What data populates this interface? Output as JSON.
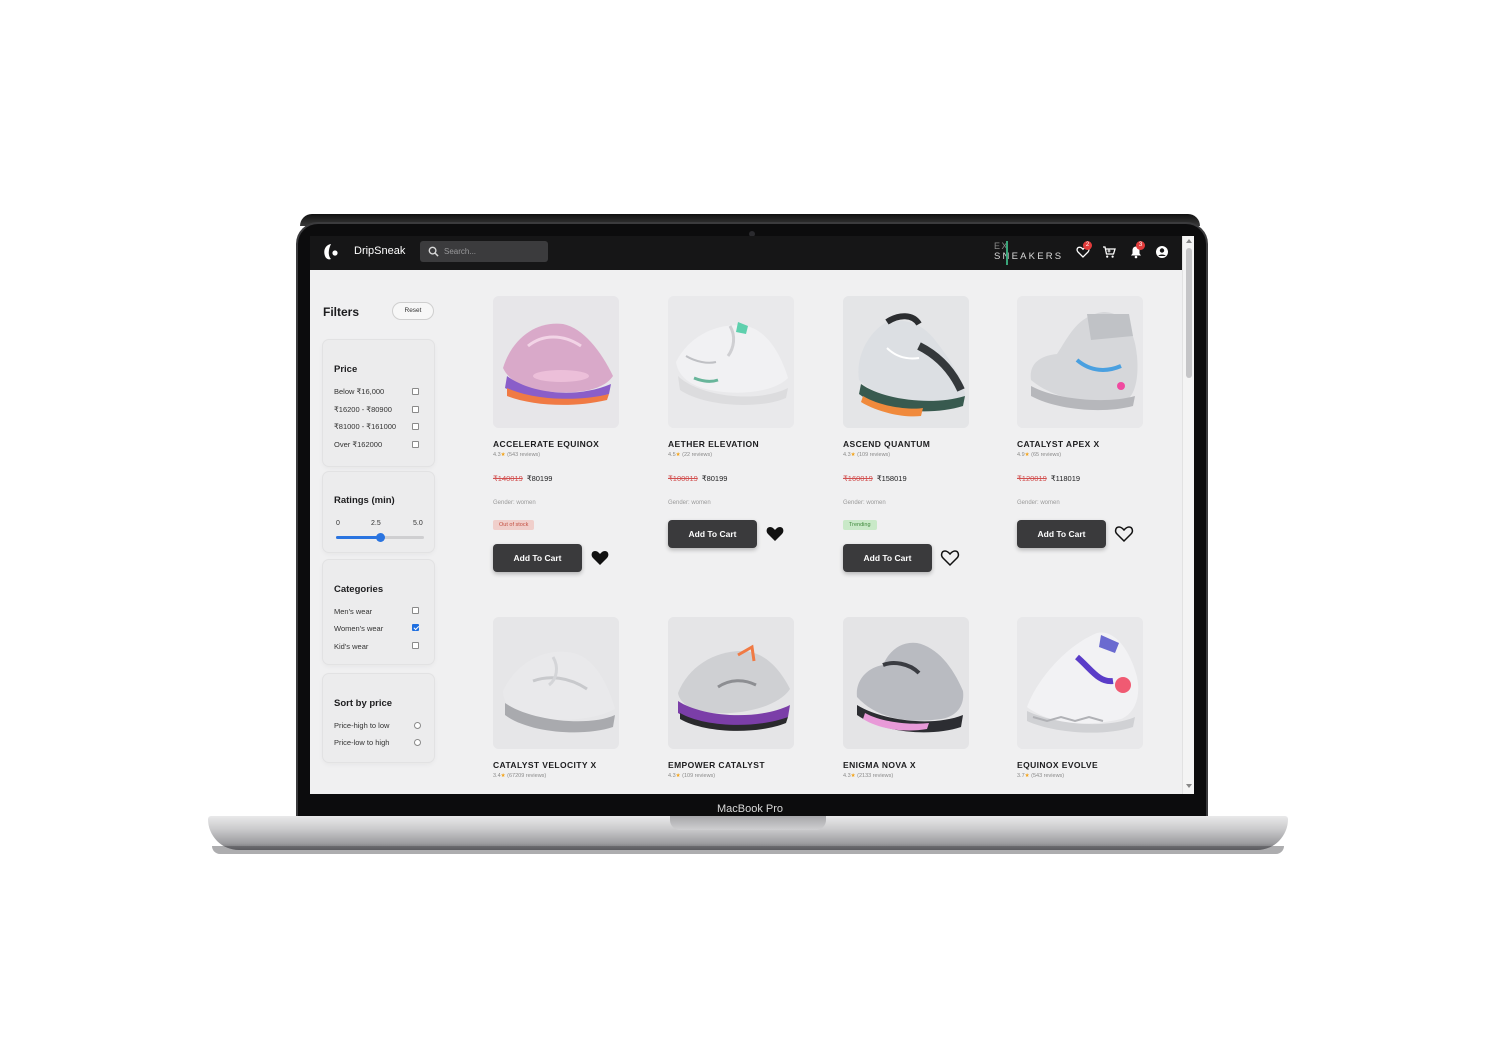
{
  "app": {
    "brand": "DripSneak",
    "device_label": "MacBook Pro"
  },
  "search": {
    "placeholder": "Search..."
  },
  "partner_logo": {
    "top": "EX",
    "word": "SNEAKERS"
  },
  "nav": {
    "wishlist_count": "2",
    "notifications_count": "3",
    "icons": [
      "heart-icon",
      "cart-icon",
      "bell-icon",
      "user-icon"
    ]
  },
  "filters": {
    "title": "Filters",
    "reset_label": "Reset",
    "price": {
      "title": "Price",
      "options": [
        {
          "label": "Below ₹16,000",
          "checked": false
        },
        {
          "label": "₹16200 - ₹80900",
          "checked": false
        },
        {
          "label": "₹81000 - ₹161000",
          "checked": false
        },
        {
          "label": "Over ₹162000",
          "checked": false
        }
      ]
    },
    "ratings": {
      "title": "Ratings (min)",
      "ticks": [
        "0",
        "2.5",
        "5.0"
      ],
      "min": 0,
      "max": 5,
      "value": 2.5
    },
    "categories": {
      "title": "Categories",
      "options": [
        {
          "label": "Men's wear",
          "checked": false
        },
        {
          "label": "Women's wear",
          "checked": true
        },
        {
          "label": "Kid's wear",
          "checked": false
        }
      ]
    },
    "sort": {
      "title": "Sort by price",
      "options": [
        {
          "label": "Price-high to low",
          "selected": false
        },
        {
          "label": "Price-low to high",
          "selected": false
        }
      ]
    }
  },
  "products": [
    {
      "name": "ACCELERATE EQUINOX",
      "rating": "4.3",
      "reviews": "(543 reviews)",
      "old_price": "₹140019",
      "price": "₹80199",
      "gender": "Gender: women",
      "status": "Out of stock",
      "cart_label": "Add To Cart",
      "wishlisted": true
    },
    {
      "name": "AETHER ELEVATION",
      "rating": "4.5",
      "reviews": "(22 reviews)",
      "old_price": "₹100019",
      "price": "₹80199",
      "gender": "Gender: women",
      "status": "",
      "cart_label": "Add To Cart",
      "wishlisted": true
    },
    {
      "name": "ASCEND QUANTUM",
      "rating": "4.3",
      "reviews": "(109 reviews)",
      "old_price": "₹160019",
      "price": "₹158019",
      "gender": "Gender: women",
      "status": "Trending",
      "cart_label": "Add To Cart",
      "wishlisted": false
    },
    {
      "name": "CATALYST APEX X",
      "rating": "4.9",
      "reviews": "(65 reviews)",
      "old_price": "₹120019",
      "price": "₹118019",
      "gender": "Gender: women",
      "status": "",
      "cart_label": "Add To Cart",
      "wishlisted": false
    },
    {
      "name": "CATALYST VELOCITY X",
      "rating": "3.4",
      "reviews": "(67209 reviews)"
    },
    {
      "name": "EMPOWER CATALYST",
      "rating": "4.3",
      "reviews": "(109 reviews)"
    },
    {
      "name": "ENIGMA NOVA X",
      "rating": "4.3",
      "reviews": "(2133 reviews)"
    },
    {
      "name": "EQUINOX EVOLVE",
      "rating": "3.7",
      "reviews": "(543 reviews)"
    }
  ],
  "colors": {
    "navbar": "#161617",
    "accent": "#2a74e0",
    "button": "#3a3a3c",
    "out_of_stock": "#f0cfcb",
    "trending": "#c9e9c8",
    "old_price": "#d25050",
    "star": "#f2a31b"
  }
}
